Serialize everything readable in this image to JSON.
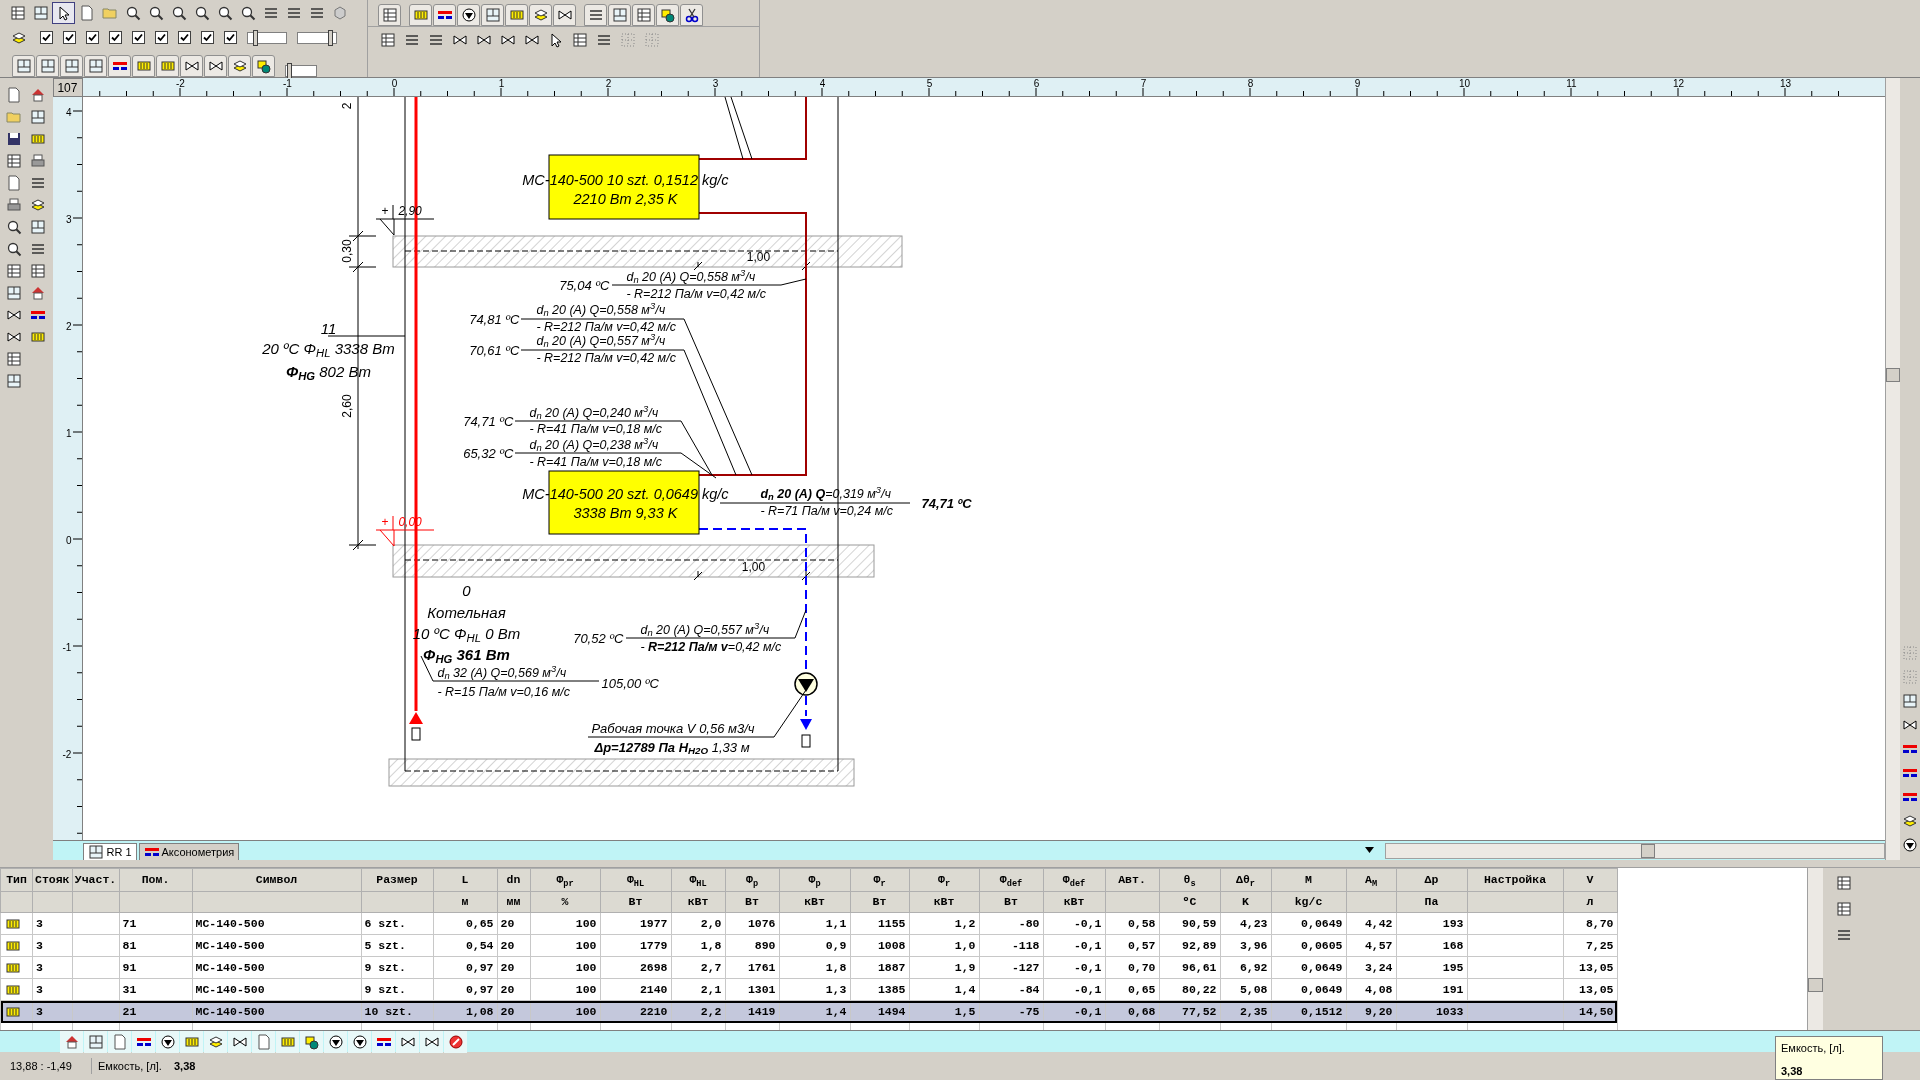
{
  "toolbar": {
    "checkboxes": [
      {
        "checked": true
      },
      {
        "checked": true
      },
      {
        "checked": true
      },
      {
        "checked": true
      },
      {
        "checked": true
      },
      {
        "checked": true
      },
      {
        "checked": true
      },
      {
        "checked": true
      },
      {
        "checked": true
      }
    ],
    "sliders": [
      {
        "level": 0.15
      },
      {
        "level": 0.9
      },
      {
        "level": 0.05
      }
    ]
  },
  "ruler": {
    "corner": "107",
    "x_labels": [
      "-2",
      "-1",
      "0",
      "1",
      "2",
      "3",
      "4",
      "5",
      "6",
      "7",
      "8",
      "9",
      "10",
      "11",
      "12",
      "13"
    ],
    "y_labels": [
      "4",
      "3",
      "2",
      "1",
      "0",
      "-1",
      "-2"
    ]
  },
  "drawing": {
    "dimension_labels": [
      "2",
      "0,30",
      "2,60",
      "1,00",
      "1,00"
    ],
    "level_marks": [
      {
        "sign": "+",
        "value": "2,90",
        "color": "#000000"
      },
      {
        "sign": "+",
        "value": "0,00",
        "color": "#ff0000"
      }
    ],
    "rooms": [
      {
        "number": "11",
        "lines": [
          "20 ºC Φ$_{HL}$ 3338 Вт",
          "**Φ$_{HG}$** 802 Вт"
        ]
      },
      {
        "number": "0",
        "name": "Котельная",
        "lines": [
          "10 ºC Φ$_{HL}$ 0 Вт",
          "**Φ$_{HG}$ 361 Вт**"
        ]
      }
    ],
    "radiators": [
      {
        "label": "МС-140-500 10 szt. 0,1512 kg/c",
        "output": "2210 Вт 2,35 K"
      },
      {
        "label": "МС-140-500 20 szt. 0,0649 kg/c",
        "output": "3338 Вт 9,33 K"
      }
    ],
    "pipe_labels": [
      {
        "temperature": "75,04 ºC",
        "temperature_bold": false,
        "line_1": "d$_{n}$ 20 (A) Q=0,558 м$^{3}$/ч",
        "line_2": "- R=212 Па/м v=0,42 м/с"
      },
      {
        "temperature": "74,81 ºC",
        "temperature_bold": false,
        "line_1": "d$_{n}$ 20 (A) Q=0,558 м$^{3}$/ч",
        "line_2": "- R=212 Па/м v=0,42 м/с"
      },
      {
        "temperature": "70,61 ºC",
        "temperature_bold": false,
        "line_1": "d$_{n}$ 20 (A) Q=0,557 м$^{3}$/ч",
        "line_2": "- R=212 Па/м v=0,42 м/с"
      },
      {
        "temperature": "74,71 ºC",
        "temperature_bold": false,
        "line_1": "d$_{n}$ 20 (A) Q=0,240 м$^{3}$/ч",
        "line_2": "- R=41 Па/м v=0,18 м/с"
      },
      {
        "temperature": "65,32 ºC",
        "temperature_bold": false,
        "line_1": "d$_{n}$ 20 (A) Q=0,238 м$^{3}$/ч",
        "line_2": "- R=41 Па/м v=0,18 м/с"
      },
      {
        "temperature": "74,71 ºC",
        "temperature_bold": true,
        "line_1": "**d$_{n}$ 20 (A) Q**=0,319 м$^{3}$/ч",
        "line_2": "- R=71 Па/м v=0,24 м/с"
      },
      {
        "temperature": "70,52 ºC",
        "temperature_bold": false,
        "line_1": "d$_{n}$ 20 (A) Q=0,557 м$^{3}$/ч",
        "line_2": "- **R=212 Па/м v**=0,42 м/с"
      },
      {
        "temperature": "105,00 ºC",
        "temperature_bold": false,
        "line_1": "d$_{n}$ 32 (A) Q=0,569 м$^{3}$/ч",
        "line_2": "- R=15 Па/м v=0,16 м/с"
      }
    ],
    "pump": {
      "line_1": "Рабочая точка V 0,56 м3/ч",
      "line_2": "**Δp=12789 Па H$_{H2O}$** 1,33 м"
    }
  },
  "tabs": [
    {
      "label": "RR 1",
      "selected": true
    },
    {
      "label": "Аксонометрия",
      "selected": false
    }
  ],
  "table": {
    "columns": [
      {
        "header": "Тип"
      },
      {
        "header": "Стояк"
      },
      {
        "header": "Участ."
      },
      {
        "header": "Пом."
      },
      {
        "header": "Символ"
      },
      {
        "header": "Размер"
      },
      {
        "header": "L",
        "unit": "м"
      },
      {
        "header": "dn",
        "unit": "мм"
      },
      {
        "header": "Φ$_{pr}$",
        "unit": "%"
      },
      {
        "header": "Φ$_{HL}$",
        "unit": "Вт"
      },
      {
        "header": "Φ$_{HL}$",
        "unit": "кВт"
      },
      {
        "header": "Φ$_{p}$",
        "unit": "Вт"
      },
      {
        "header": "Φ$_{p}$",
        "unit": "кВт"
      },
      {
        "header": "Φ$_{r}$",
        "unit": "Вт"
      },
      {
        "header": "Φ$_{r}$",
        "unit": "кВт"
      },
      {
        "header": "Φ$_{def}$",
        "unit": "Вт"
      },
      {
        "header": "Φ$_{def}$",
        "unit": "кВт"
      },
      {
        "header": "Авт."
      },
      {
        "header": "θ$_{s}$",
        "unit": "ºC"
      },
      {
        "header": "Δθ$_{r}$",
        "unit": "K"
      },
      {
        "header": "M",
        "unit": "kg/c"
      },
      {
        "header": "A$_{M}$"
      },
      {
        "header": "Δp",
        "unit": "Па"
      },
      {
        "header": "Настройка"
      },
      {
        "header": "V",
        "unit": "л"
      }
    ],
    "rows": [
      {
        "kind": "radiator",
        "selected": false,
        "cells": [
          "",
          "3",
          "",
          "71",
          "МС-140-500",
          "6 szt.",
          "0,65",
          "20",
          "100",
          "1977",
          "2,0",
          "1076",
          "1,1",
          "1155",
          "1,2",
          "-80",
          "-0,1",
          "0,58",
          "90,59",
          "4,23",
          "0,0649",
          "4,42",
          "193",
          "",
          "8,70"
        ]
      },
      {
        "kind": "radiator",
        "selected": false,
        "cells": [
          "",
          "3",
          "",
          "81",
          "МС-140-500",
          "5 szt.",
          "0,54",
          "20",
          "100",
          "1779",
          "1,8",
          "890",
          "0,9",
          "1008",
          "1,0",
          "-118",
          "-0,1",
          "0,57",
          "92,89",
          "3,96",
          "0,0605",
          "4,57",
          "168",
          "",
          "7,25"
        ]
      },
      {
        "kind": "radiator",
        "selected": false,
        "cells": [
          "",
          "3",
          "",
          "91",
          "МС-140-500",
          "9 szt.",
          "0,97",
          "20",
          "100",
          "2698",
          "2,7",
          "1761",
          "1,8",
          "1887",
          "1,9",
          "-127",
          "-0,1",
          "0,70",
          "96,61",
          "6,92",
          "0,0649",
          "3,24",
          "195",
          "",
          "13,05"
        ]
      },
      {
        "kind": "radiator",
        "selected": false,
        "cells": [
          "",
          "3",
          "",
          "31",
          "МС-140-500",
          "9 szt.",
          "0,97",
          "20",
          "100",
          "2140",
          "2,1",
          "1301",
          "1,3",
          "1385",
          "1,4",
          "-84",
          "-0,1",
          "0,65",
          "80,22",
          "5,08",
          "0,0649",
          "4,08",
          "191",
          "",
          "13,05"
        ]
      },
      {
        "kind": "radiator",
        "selected": true,
        "cells": [
          "",
          "3",
          "",
          "21",
          "МС-140-500",
          "10 szt.",
          "1,08",
          "20",
          "100",
          "2210",
          "2,2",
          "1419",
          "1,4",
          "1494",
          "1,5",
          "-75",
          "-0,1",
          "0,68",
          "77,52",
          "2,35",
          "0,1512",
          "9,20",
          "1033",
          "",
          "14,50"
        ]
      }
    ]
  },
  "status_bar": {
    "coordinates": "13,88 : -1,49",
    "field_label": "Емкость, [л].",
    "field_value": "3,38"
  },
  "tooltip": {
    "title": "Емкость, [л].",
    "value": "3,38"
  }
}
